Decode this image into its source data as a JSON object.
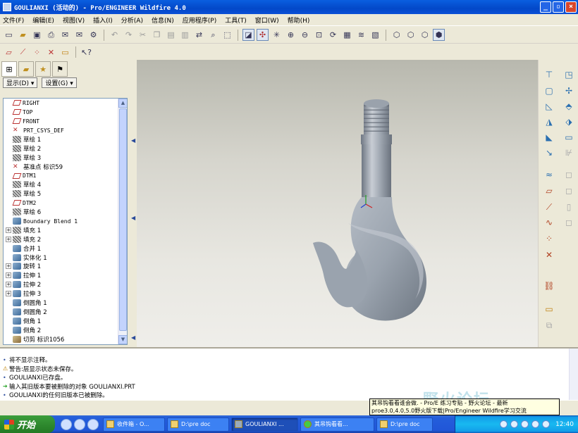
{
  "window": {
    "title": "GOULIANXI (活动的) - Pro/ENGINEER Wildfire 4.0",
    "buttons": [
      "minimize",
      "maximize",
      "close"
    ]
  },
  "menu": [
    "文件(F)",
    "编辑(E)",
    "视图(V)",
    "插入(I)",
    "分析(A)",
    "信息(N)",
    "应用程序(P)",
    "工具(T)",
    "窗口(W)",
    "帮助(H)"
  ],
  "toolbar_icons": [
    "new-icon",
    "open-icon",
    "save-icon",
    "print-icon",
    "email-icon",
    "email-link-icon",
    "regenerate-icon",
    "undo-icon",
    "redo-icon",
    "cut-icon",
    "copy-icon",
    "paste-icon",
    "paste-special-icon",
    "regen-manager-icon",
    "find-icon",
    "select-box-icon",
    "repaint-icon",
    "spin-center-icon",
    "orient-icon",
    "zoom-in-icon",
    "zoom-out-icon",
    "refit-icon",
    "reorient-icon",
    "saved-views-icon",
    "layers-icon",
    "view-manager-icon",
    "wireframe-icon",
    "hidden-line-icon",
    "no-hidden-icon",
    "shading-icon"
  ],
  "panel": {
    "display_label": "显示(D) ▾",
    "settings_label": "设置(G) ▾",
    "tree": [
      {
        "label": "RIGHT",
        "icon": "datum",
        "mono": true,
        "exp": false
      },
      {
        "label": "TOP",
        "icon": "datum",
        "mono": true,
        "exp": false
      },
      {
        "label": "FRONT",
        "icon": "datum",
        "mono": true,
        "exp": false
      },
      {
        "label": "PRT_CSYS_DEF",
        "icon": "csys",
        "mono": true,
        "exp": false
      },
      {
        "label": "草绘 1",
        "icon": "sketch",
        "mono": false,
        "exp": false
      },
      {
        "label": "草绘 2",
        "icon": "sketch",
        "mono": false,
        "exp": false
      },
      {
        "label": "草绘 3",
        "icon": "sketch",
        "mono": false,
        "exp": false
      },
      {
        "label": "基准点 标识59",
        "icon": "csys",
        "mono": false,
        "exp": false
      },
      {
        "label": "DTM1",
        "icon": "datum",
        "mono": true,
        "exp": false
      },
      {
        "label": "草绘 4",
        "icon": "sketch",
        "mono": false,
        "exp": false
      },
      {
        "label": "草绘 5",
        "icon": "sketch",
        "mono": false,
        "exp": false
      },
      {
        "label": "DTM2",
        "icon": "datum",
        "mono": true,
        "exp": false
      },
      {
        "label": "草绘 6",
        "icon": "sketch",
        "mono": false,
        "exp": false
      },
      {
        "label": "Boundary Blend 1",
        "icon": "feat",
        "mono": true,
        "exp": false
      },
      {
        "label": "填充 1",
        "icon": "sketch",
        "mono": false,
        "exp": true
      },
      {
        "label": "填充 2",
        "icon": "sketch",
        "mono": false,
        "exp": true
      },
      {
        "label": "合并 1",
        "icon": "feat",
        "mono": false,
        "exp": false
      },
      {
        "label": "实体化 1",
        "icon": "feat",
        "mono": false,
        "exp": false
      },
      {
        "label": "旋转 1",
        "icon": "feat",
        "mono": false,
        "exp": true
      },
      {
        "label": "拉伸 1",
        "icon": "feat",
        "mono": false,
        "exp": true
      },
      {
        "label": "拉伸 2",
        "icon": "feat",
        "mono": false,
        "exp": true
      },
      {
        "label": "拉伸 3",
        "icon": "feat",
        "mono": false,
        "exp": true
      },
      {
        "label": "倒圆角 1",
        "icon": "feat",
        "mono": false,
        "exp": false
      },
      {
        "label": "倒圆角 2",
        "icon": "feat",
        "mono": false,
        "exp": false
      },
      {
        "label": "倒角 1",
        "icon": "feat",
        "mono": false,
        "exp": false
      },
      {
        "label": "倒角 2",
        "icon": "feat",
        "mono": false,
        "exp": false
      },
      {
        "label": "切剪 标识1056",
        "icon": "cut",
        "mono": false,
        "exp": false
      }
    ]
  },
  "messages": [
    {
      "type": "info",
      "text": "将不显示注释。"
    },
    {
      "type": "warn",
      "text": "警告:层显示状态未保存。"
    },
    {
      "type": "info",
      "text": "GOULIANXI已存盘。"
    },
    {
      "type": "prompt",
      "text": "输入其旧版本要被删除的对象   GOULIANXI.PRT"
    },
    {
      "type": "info",
      "text": "GOULIANXI的任何旧版本已被删除。"
    }
  ],
  "tooltip": {
    "line1": "其吊钩看看谁会做. - Pro/E 练习专贴 - 野火论坛 - 最新",
    "line2": "proe3.0,4.0,5.0野火版下载|Pro/Engineer Wildfire学习交流"
  },
  "watermark": "野火论坛",
  "taskbar": {
    "start_label": "开始",
    "tasks": [
      {
        "label": "收件箱 - O...",
        "active": false
      },
      {
        "label": "D:\\pre doc",
        "active": false
      },
      {
        "label": "GOULIANXI ...",
        "active": true
      },
      {
        "label": "其吊钩看看...",
        "active": false
      },
      {
        "label": "D:\\pre doc",
        "active": false
      }
    ],
    "clock": "12:40"
  },
  "colors": {
    "titlebar": "#0348c8",
    "model": "#9aa3ae",
    "viewport_top": "#b8b8ae",
    "viewport_bottom": "#efeeea"
  }
}
